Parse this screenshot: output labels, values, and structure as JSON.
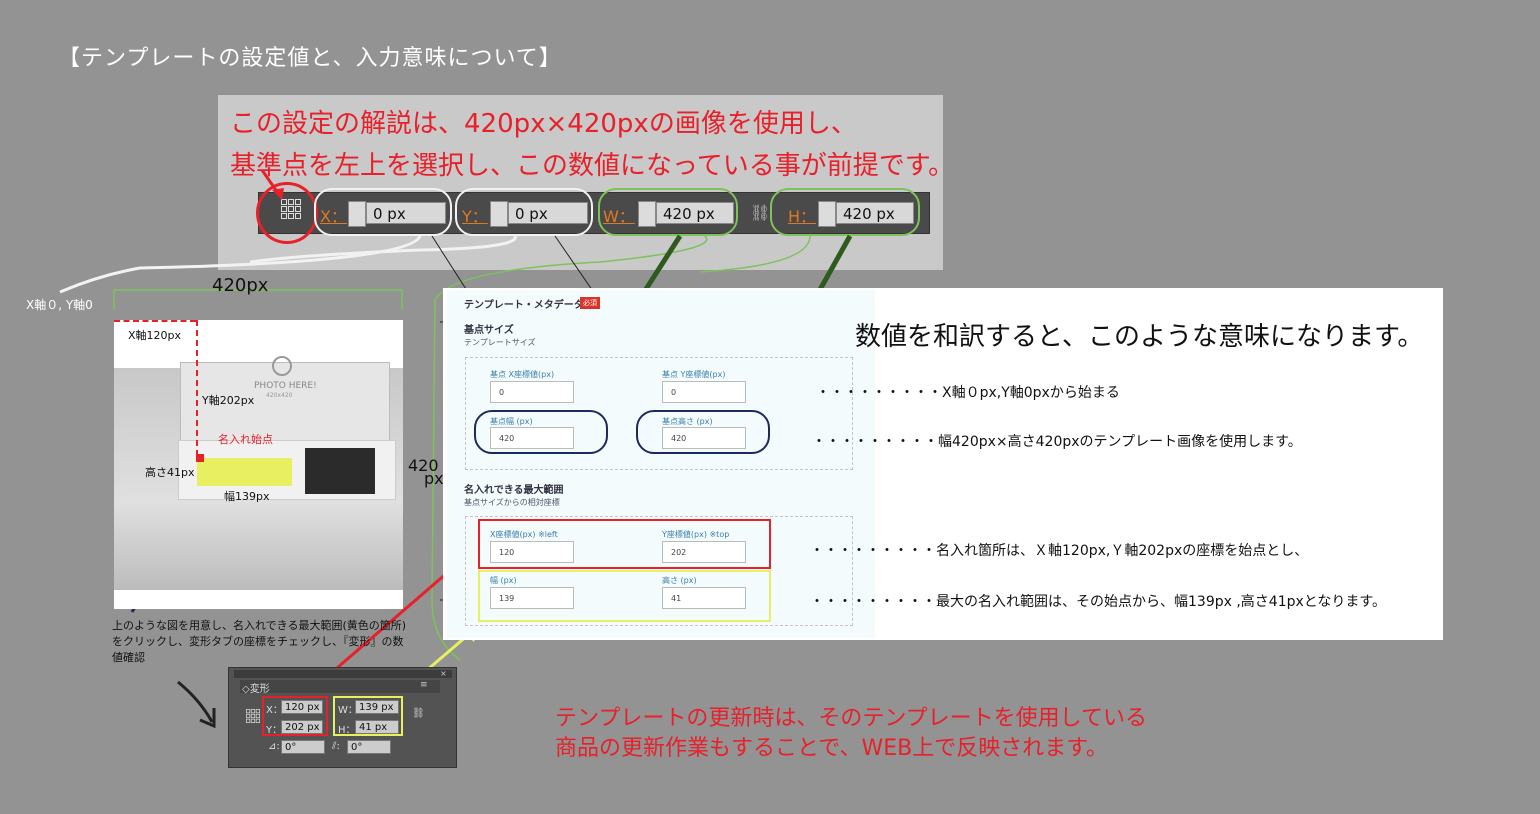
{
  "page_title": "【テンプレートの設定値と、入力意味について】",
  "top_note": {
    "line1": "この設定の解説は、420px×420pxの画像を使用し、",
    "line2": "基準点を左上を選択し、この数値になっている事が前提です。"
  },
  "toolbar": {
    "x_label": "X：",
    "x_value": "0 px",
    "y_label": "Y：",
    "y_value": "0 px",
    "w_label": "W：",
    "w_value": "420 px",
    "h_label": "H：",
    "h_value": "420 px"
  },
  "origin_label": "X軸０, Y軸0",
  "width_label": "420px",
  "height_label_num": "420",
  "height_label_unit": "px",
  "photo": {
    "x_axis": "X軸120px",
    "y_axis": "Y軸202px",
    "start_point": "名入れ始点",
    "height": "高さ41px",
    "width": "幅139px",
    "photo_here": "PHOTO HERE!",
    "photo_sub": "420x420"
  },
  "instruction": "上のような図を用意し、名入れできる最大範囲(黄色の箇所)をクリックし、変形タブの座標をチェックし、『変形』の数値確認",
  "form": {
    "title": "テンプレート・メタデータ",
    "required": "必須",
    "section1": "基点サイズ",
    "section1_sub": "テンプレートサイズ",
    "base_x_label": "基点 X座標値(px)",
    "base_x_value": "0",
    "base_y_label": "基点 Y座標値(px)",
    "base_y_value": "0",
    "base_w_label": "基点幅 (px)",
    "base_w_value": "420",
    "base_h_label": "基点高さ (px)",
    "base_h_value": "420",
    "section2": "名入れできる最大範囲",
    "section2_sub": "基点サイズからの相対座標",
    "x_label": "X座標値(px) ※left",
    "x_value": "120",
    "y_label": "Y座標値(px) ※top",
    "y_value": "202",
    "w_label": "幅 (px)",
    "w_value": "139",
    "h_label": "高さ (px)",
    "h_value": "41"
  },
  "explain": {
    "heading": "数値を和訳すると、このような意味になります。",
    "line1": "・・・・・・・・・X軸０px,Y軸0pxから始まる",
    "line2": "・・・・・・・・・幅420px×高さ420pxのテンプレート画像を使用します。",
    "line3": "・・・・・・・・・名入れ箇所は、Ｘ軸120px,Ｙ軸202pxの座標を始点とし、",
    "line4": "・・・・・・・・・最大の名入れ範囲は、その始点から、幅139px ,高さ41pxとなります。"
  },
  "transform_panel": {
    "tab": "◇変形",
    "x_label": "X：",
    "x_value": "120 px",
    "y_label": "Y：",
    "y_value": "202 px",
    "w_label": "W：",
    "w_value": "139 px",
    "h_label": "H：",
    "h_value": "41 px",
    "angle1": "0°",
    "angle2": "0°"
  },
  "bottom_note": {
    "line1": "テンプレートの更新時は、そのテンプレートを使用している",
    "line2": "商品の更新作業もすることで、WEB上で反映されます。"
  },
  "colors": {
    "red": "#e8202a",
    "green": "#2e5a1e",
    "yellow": "#e6f060",
    "navy": "#1c2a5c"
  }
}
